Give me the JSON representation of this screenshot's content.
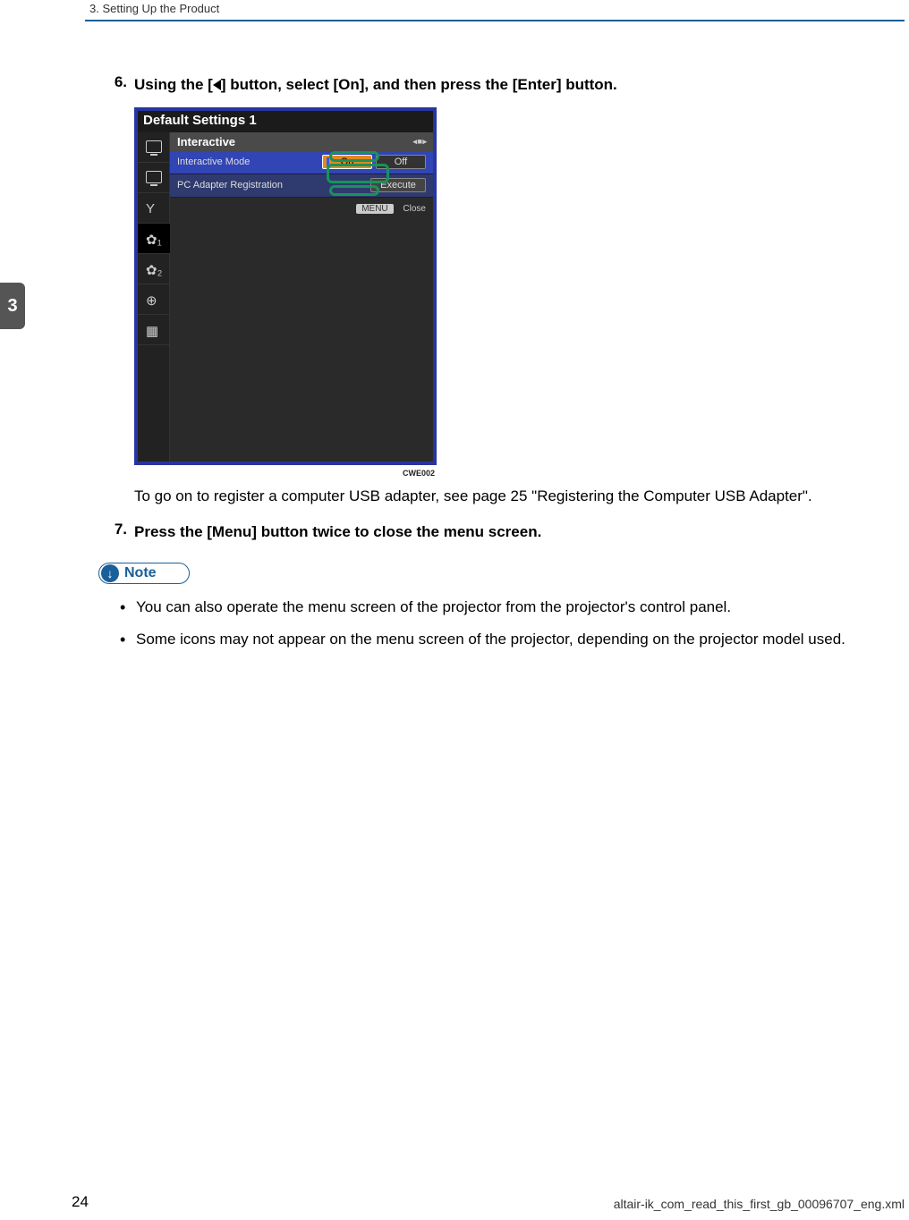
{
  "header": {
    "chapter_line": "3. Setting Up the Product",
    "chapter_tab": "3"
  },
  "steps": {
    "s6": {
      "num": "6.",
      "text_parts": {
        "a": "Using the [",
        "b": "] button, select [On], and then press the [Enter] button."
      },
      "after_img": "To go on to register a computer USB adapter, see page 25 \"Registering the Computer USB Adapter\"."
    },
    "s7": {
      "num": "7.",
      "text": "Press the [Menu] button twice to close the menu screen."
    }
  },
  "osd": {
    "title": "Default Settings 1",
    "section": "Interactive",
    "row1": {
      "label": "Interactive Mode",
      "on": "On",
      "off": "Off"
    },
    "row2": {
      "label": "PC Adapter Registration",
      "action": "Execute"
    },
    "menu_btn": "MENU",
    "close": "Close",
    "img_code": "CWE002"
  },
  "note": {
    "label": "Note",
    "bullets": [
      "You can also operate the menu screen of the projector from the projector's control panel.",
      "Some icons may not appear on the menu screen of the projector, depending on the projector model used."
    ]
  },
  "footer": {
    "page": "24",
    "file": "altair-ik_com_read_this_first_gb_00096707_eng.xml"
  }
}
